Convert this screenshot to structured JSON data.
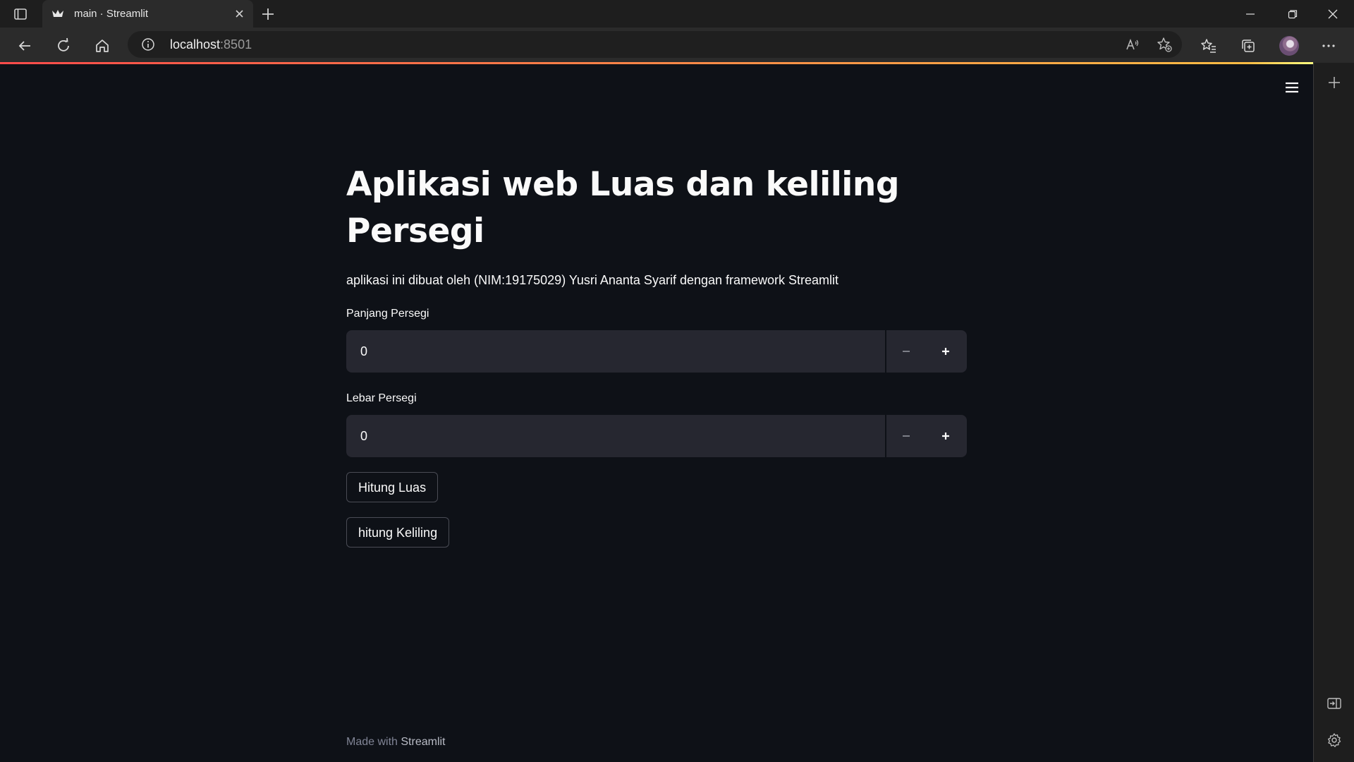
{
  "browser": {
    "tab_title": "main · Streamlit",
    "url_host": "localhost",
    "url_port": ":8501"
  },
  "app": {
    "title": "Aplikasi web Luas dan keliling Persegi",
    "caption": "aplikasi ini dibuat oleh (NIM:19175029) Yusri Ananta Syarif dengan framework Streamlit",
    "inputs": [
      {
        "label": "Panjang Persegi",
        "value": "0"
      },
      {
        "label": "Lebar Persegi",
        "value": "0"
      }
    ],
    "buttons": {
      "luas": "Hitung Luas",
      "keliling": "hitung Keliling"
    },
    "footer": {
      "made_with": "Made with ",
      "brand": "Streamlit"
    }
  },
  "colors": {
    "background": "#0e1117",
    "input_bg": "#262730",
    "accent_start": "#ff4b4b",
    "accent_end": "#fffd80"
  }
}
